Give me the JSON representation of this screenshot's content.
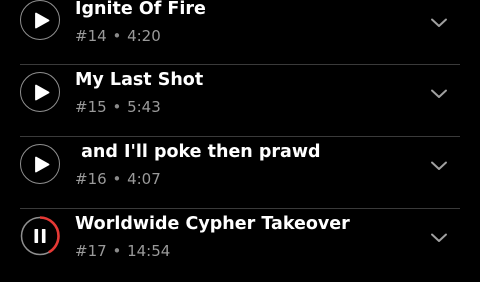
{
  "tracks": [
    {
      "title": "Ignite Of Fire",
      "number": "#14",
      "separator": "•",
      "duration": "4:20",
      "state": "play",
      "state_icon": "play-icon"
    },
    {
      "title": "My Last Shot",
      "number": "#15",
      "separator": "•",
      "duration": "5:43",
      "state": "play",
      "state_icon": "play-icon"
    },
    {
      "title": " and I'll poke then prawd",
      "number": "#16",
      "separator": "•",
      "duration": "4:07",
      "state": "play",
      "state_icon": "play-icon"
    },
    {
      "title": "Worldwide Cypher Takeover",
      "number": "#17",
      "separator": "•",
      "duration": "14:54",
      "state": "playing",
      "state_icon": "pause-icon",
      "progress": 0.42
    }
  ],
  "colors": {
    "background": "#000000",
    "title": "#ffffff",
    "meta": "#9a9a9a",
    "ring": "#8f8f8f",
    "progress": "#e53935",
    "divider": "#3a3a3a"
  },
  "icons": {
    "expand": "chevron-down-icon"
  }
}
